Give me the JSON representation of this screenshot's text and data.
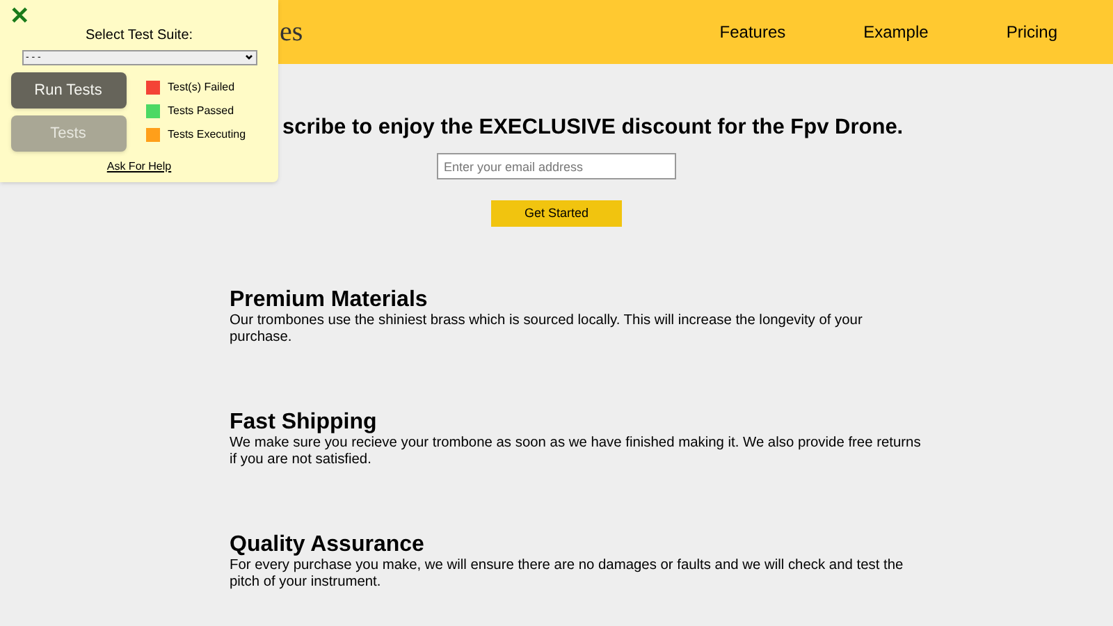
{
  "header": {
    "logo_text": "es",
    "nav": [
      "Features",
      "Example",
      "Pricing"
    ]
  },
  "hero": {
    "heading": "scribe to enjoy the EXECLUSIVE discount for the Fpv Drone.",
    "email_placeholder": "Enter your email address",
    "button": "Get Started"
  },
  "features": [
    {
      "title": "Premium Materials",
      "text": "Our trombones use the shiniest brass which is sourced locally. This will increase the longevity of your purchase."
    },
    {
      "title": "Fast Shipping",
      "text": "We make sure you recieve your trombone as soon as we have finished making it. We also provide free returns if you are not satisfied."
    },
    {
      "title": "Quality Assurance",
      "text": "For every purchase you make, we will ensure there are no damages or faults and we will check and test the pitch of your instrument."
    }
  ],
  "test_panel": {
    "close": "✕",
    "label": "Select Test Suite:",
    "select_value": "- - -",
    "buttons": [
      {
        "label": "Run Tests",
        "disabled": false
      },
      {
        "label": "Tests",
        "disabled": true
      }
    ],
    "legend": [
      {
        "label": "Test(s) Failed",
        "color": "#f44336"
      },
      {
        "label": "Tests Passed",
        "color": "#4cd964"
      },
      {
        "label": "Tests Executing",
        "color": "#ff9f1a"
      }
    ],
    "help_link": "Ask For Help"
  }
}
